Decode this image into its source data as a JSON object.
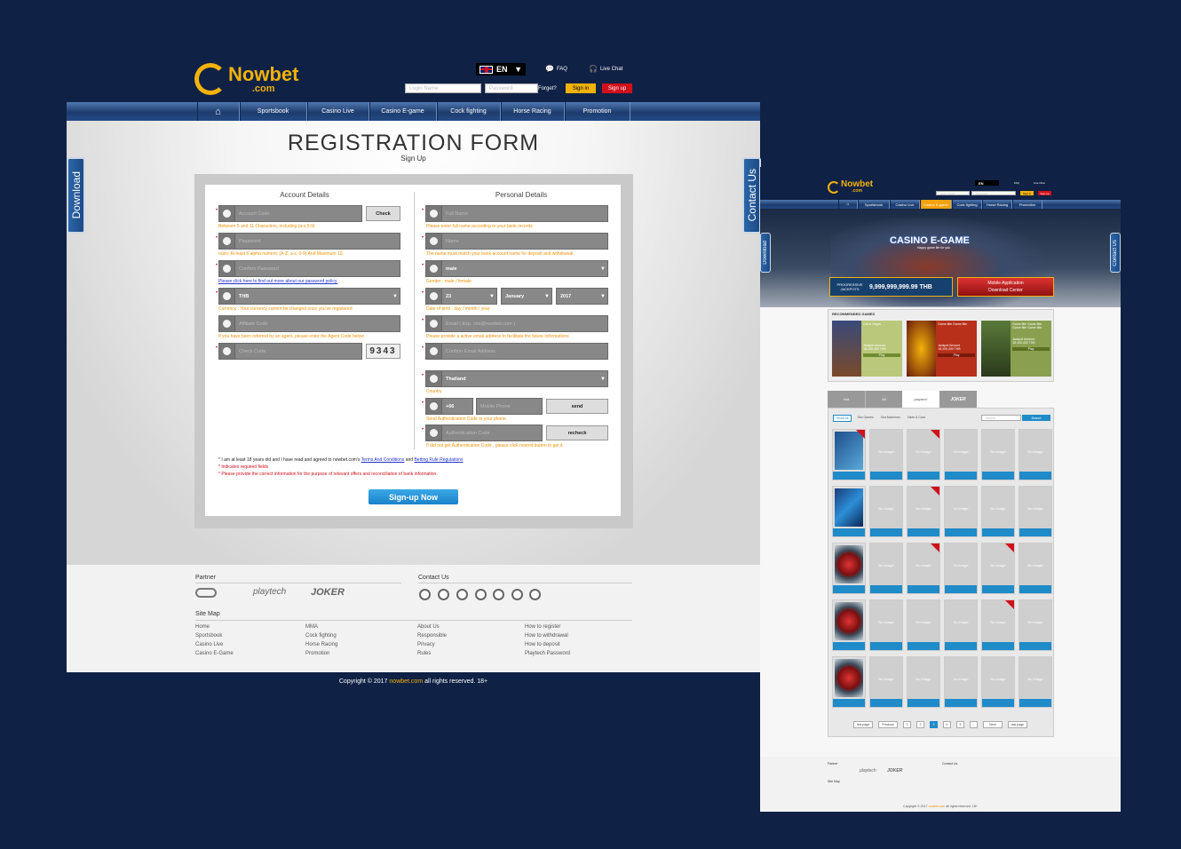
{
  "brand": {
    "logo_text": "Nowbet",
    "logo_sub": ".com"
  },
  "header": {
    "lang": "EN",
    "faq": "FAQ",
    "live_chat": "Live Chat",
    "login_placeholder": "Login Name",
    "password_placeholder": "Password",
    "forgot": "Forget?",
    "signin": "Sign in",
    "signup": "Sign up"
  },
  "nav": [
    "Sportsbook",
    "Casino Live",
    "Casino E-game",
    "Cock fighting",
    "Horse Racing",
    "Promotion"
  ],
  "side_tabs": {
    "download": "Download",
    "contact": "Contact Us"
  },
  "form": {
    "title": "REGISTRATION FORM",
    "subtitle": "Sign Up",
    "account_title": "Account Details",
    "personal_title": "Personal Details",
    "account_code_ph": "Account Code",
    "check_btn": "Check",
    "account_code_hint": "Between 5 and 11 Characters, including (a-z,0-9)",
    "password_ph": "Password",
    "password_hint": "rules: At least 6 alpha numeric (A-Z, a-z, 0-9) And Maximum 10.",
    "confirm_password_ph": "Confirm Password",
    "password_policy_link": "Please click here to find out more about our password policy.",
    "currency_value": "THB",
    "currency_hint": "Currency : Your currency cannot be changed once you've registered",
    "affiliate_ph": "Affiliate Code",
    "affiliate_hint": "If you have been referred by an agent, please enter the Agent Code below",
    "check_code_ph": "Check Code",
    "captcha": "9343",
    "full_name_ph": "Full Name",
    "full_name_hint": "Please enter full name according to your bank records",
    "name_ph": "Name",
    "name_hint": "The name must match your bank account name for deposit and withdrawal",
    "gender_value": "male",
    "gender_hint": "Gender : male / female",
    "dob_day": "23",
    "dob_month": "January",
    "dob_year": "2017",
    "dob_hint": "Date of birth : day / month / year",
    "email_ph": "Email ( Exp. xxx@nowbet.com )",
    "email_hint": "Please provide a active email address to facilitate the future informations",
    "confirm_email_ph": "Confirm Email Address",
    "country_value": "Thailand",
    "country_hint": "Country",
    "phone_code": "+66",
    "mobile_ph": "Mobile Phone",
    "send_btn": "send",
    "phone_hint": "Send Authentication Code to your phone.",
    "auth_ph": "Authentication Code",
    "recheck_btn": "recheck",
    "auth_hint": "If did not get Authentication Code , please click resend button to get it.",
    "agree_text": "* I am at least 18 years old and I have read and agreed to nowbet.com's",
    "terms_link": "Terms And Conditions",
    "and_text": "and",
    "rules_link": "Betting Rule Regulations",
    "required_note": "* Indicates required fields",
    "provide_note": "* Please provide the correct information for the purpose of relevant offers and reconciliation of bank information.",
    "signup_now": "Sign-up Now"
  },
  "footer": {
    "partner_title": "Partner",
    "partners": [
      "playtech",
      "JOKER"
    ],
    "contact_title": "Contact Us",
    "sitemap_title": "Site Map",
    "sitemap_cols": [
      [
        "Home",
        "Sportsbook",
        "Casino Live",
        "Casino E-Game"
      ],
      [
        "MMA",
        "Cock fighting",
        "Horse Racing",
        "Promotion"
      ],
      [
        "About Us",
        "Responsible",
        "Privacy",
        "Rules"
      ],
      [
        "How to register",
        "How to withdrawal",
        "How to deposit",
        "Playtech Password"
      ]
    ],
    "copyright_pre": "Copyright © 2017",
    "copyright_site": "nowbet.com",
    "copyright_post": "all rights reserved. 18+"
  },
  "egame": {
    "banner_title": "CASINO E-GAME",
    "banner_sub": "Happy game life for you",
    "jackpot_label": "PROGRESSIVE JACKPOTS",
    "jackpot_value": "9,999,999,999.99 THB",
    "mobile_app": "Mobile Application",
    "download_center": "Download Center",
    "recommended": "RECOMMENDED GAMES",
    "rec_games": [
      {
        "title": "Cat in Vegas",
        "amount": "18,400,430 THB"
      },
      {
        "title": "Game title Game title",
        "amount": "18,400,430 THB"
      },
      {
        "title": "Game title Game title Game title Game title",
        "amount": "18,400,430 THB"
      }
    ],
    "jackpot_amount_label": "Jackpot Amount",
    "play": "Play",
    "tabs": [
      "Hot",
      "All",
      "playtech",
      "JOKER"
    ],
    "filters": [
      "Show All",
      "Slot Games",
      "Slot Machines",
      "Table & Card"
    ],
    "search_ph": "Search",
    "search_btn": "Search",
    "no_image": "No image",
    "pagination": [
      "first page",
      "Previous",
      "1",
      "2",
      "3",
      "4",
      "5",
      "...",
      "Next",
      "last page"
    ]
  }
}
